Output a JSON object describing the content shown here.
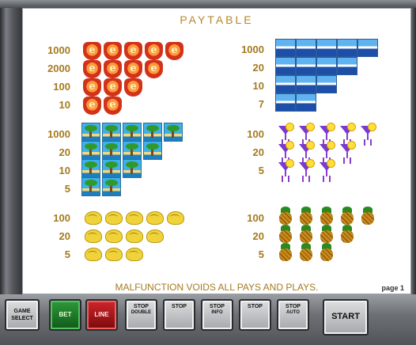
{
  "title": "PAYTABLE",
  "footer": "MALFUNCTION VOIDS ALL PAYS AND PLAYS.",
  "page": "page 1",
  "groups": [
    {
      "symbol": "e-badge-icon",
      "pays": [
        "1000",
        "2000",
        "100",
        "10"
      ]
    },
    {
      "symbol": "cruise-ship-icon",
      "pays": [
        "1000",
        "20",
        "10",
        "7"
      ]
    },
    {
      "symbol": "palm-island-icon",
      "pays": [
        "1000",
        "20",
        "10",
        "5"
      ]
    },
    {
      "symbol": "cocktail-icon",
      "pays": [
        "100",
        "20",
        "5"
      ]
    },
    {
      "symbol": "banana-icon",
      "pays": [
        "100",
        "20",
        "5"
      ]
    },
    {
      "symbol": "pineapple-icon",
      "pays": [
        "100",
        "20",
        "5"
      ]
    }
  ],
  "buttons": {
    "game_select": "GAME SELECT",
    "bet": "BET",
    "line": "LINE",
    "stop1": "STOP",
    "stop1_sub": "DOUBLE",
    "stop2": "STOP",
    "stop3": "STOP",
    "stop3_sub": "INFO",
    "stop4": "STOP",
    "stop5": "STOP",
    "stop5_sub": "AUTO",
    "start": "START"
  }
}
